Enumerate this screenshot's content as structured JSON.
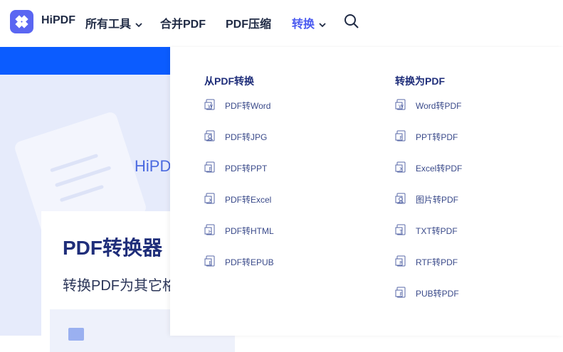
{
  "nav": {
    "brand": "HiPDF",
    "items": [
      {
        "label": "所有工具",
        "has_chevron": true,
        "active": false
      },
      {
        "label": "合并PDF",
        "has_chevron": false,
        "active": false
      },
      {
        "label": "PDF压缩",
        "has_chevron": false,
        "active": false
      },
      {
        "label": "转换",
        "has_chevron": true,
        "active": true
      }
    ],
    "colors": {
      "text": "#1f2a44",
      "active": "#4b5bf0",
      "logo_bg": "#5a66f2"
    }
  },
  "hero": {
    "bg_text": "HiPD",
    "card_title": "PDF转换器",
    "card_subtitle": "转换PDF为其它格",
    "colors": {
      "band": "#0b5cff",
      "background": "#e6ebfb"
    }
  },
  "dropdown": {
    "from_pdf": {
      "heading": "从PDF转换",
      "items": [
        {
          "label": "PDF转Word",
          "icon": "word-doc-icon",
          "glyph": "W"
        },
        {
          "label": "PDF转JPG",
          "icon": "image-doc-icon",
          "glyph": ""
        },
        {
          "label": "PDF转PPT",
          "icon": "ppt-doc-icon",
          "glyph": "P"
        },
        {
          "label": "PDF转Excel",
          "icon": "excel-doc-icon",
          "glyph": "X"
        },
        {
          "label": "PDF转HTML",
          "icon": "html-doc-icon",
          "glyph": "H"
        },
        {
          "label": "PDF转EPUB",
          "icon": "epub-doc-icon",
          "glyph": "E"
        }
      ]
    },
    "to_pdf": {
      "heading": "转换为PDF",
      "items": [
        {
          "label": "Word转PDF",
          "icon": "word-doc-icon",
          "glyph": "W"
        },
        {
          "label": "PPT转PDF",
          "icon": "ppt-doc-icon",
          "glyph": "P"
        },
        {
          "label": "Excel转PDF",
          "icon": "excel-doc-icon",
          "glyph": "X"
        },
        {
          "label": "图片转PDF",
          "icon": "image-doc-icon",
          "glyph": ""
        },
        {
          "label": "TXT转PDF",
          "icon": "txt-doc-icon",
          "glyph": "T"
        },
        {
          "label": "RTF转PDF",
          "icon": "rtf-doc-icon",
          "glyph": "R"
        },
        {
          "label": "PUB转PDF",
          "icon": "pub-doc-icon",
          "glyph": "P"
        }
      ]
    },
    "colors": {
      "heading": "#1f2e7a",
      "item": "#3a4a8a",
      "icon": "#5a6aa8"
    }
  }
}
